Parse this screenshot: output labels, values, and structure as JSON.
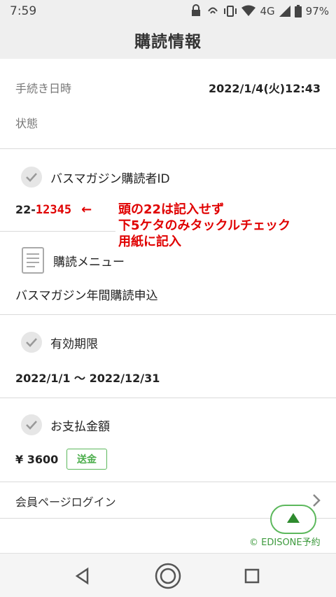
{
  "status_bar": {
    "time": "7:59",
    "network": "4G",
    "battery": "97%"
  },
  "header": {
    "title": "購読情報"
  },
  "procedure": {
    "date_label": "手続き日時",
    "date_value": "2022/1/4(火)12:43",
    "status_label": "状態"
  },
  "subscriber": {
    "label": "バスマガジン購読者ID",
    "id_prefix": "22-",
    "id_number": "12345",
    "arrow": "←",
    "annotation_lines": [
      "頭の22は記入せず",
      "下5ケタのみタックルチェック",
      "用紙に記入"
    ]
  },
  "menu": {
    "label": "購読メニュー",
    "value": "バスマガジン年間購読申込"
  },
  "expiry": {
    "label": "有効期限",
    "value": "2022/1/1 〜 2022/12/31"
  },
  "payment": {
    "label": "お支払金額",
    "value": "¥ 3600",
    "badge": "送金"
  },
  "login": {
    "label": "会員ページログイン"
  },
  "credit": "© EDISONE予約",
  "colors": {
    "accent_green": "#5cb85c",
    "annotation_red": "#e00000"
  }
}
